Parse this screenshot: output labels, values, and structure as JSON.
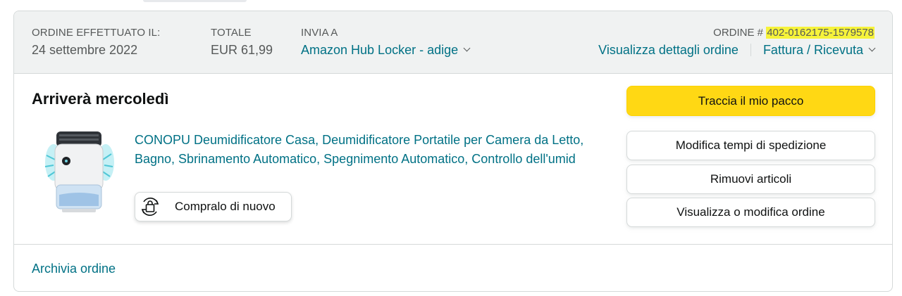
{
  "header": {
    "order_placed_label": "ORDINE EFFETTUATO IL:",
    "order_placed_value": "24 settembre 2022",
    "total_label": "TOTALE",
    "total_value": "EUR 61,99",
    "ship_to_label": "INVIA A",
    "ship_to_value": "Amazon Hub Locker - adige",
    "order_number_label": "ORDINE #",
    "order_number_value": "402-0162175-1579578",
    "order_details_link": "Visualizza dettagli ordine",
    "invoice_link": "Fattura / Ricevuta"
  },
  "shipment": {
    "delivery_status": "Arriverà mercoledì",
    "product_title": "CONOPU Deumidificatore Casa, Deumidificatore Portatile per Camera da Letto, Bagno, Sbrinamento Automatico, Spegnimento Automatico, Controllo dell'umid",
    "buy_again_label": "Compralo di nuovo"
  },
  "actions": {
    "track_package": "Traccia il mio pacco",
    "change_delivery": "Modifica tempi di spedizione",
    "remove_items": "Rimuovi articoli",
    "view_edit_order": "Visualizza o modifica ordine"
  },
  "footer": {
    "archive_order": "Archivia ordine"
  },
  "colors": {
    "link": "#007185",
    "primary_button": "#FFD814",
    "header_bg": "#F0F2F2",
    "highlight": "#F6F33A"
  },
  "icons": {
    "ship_to_dropdown": "chevron-down-icon",
    "invoice_dropdown": "chevron-down-icon",
    "buy_again": "reorder-bag-icon"
  }
}
